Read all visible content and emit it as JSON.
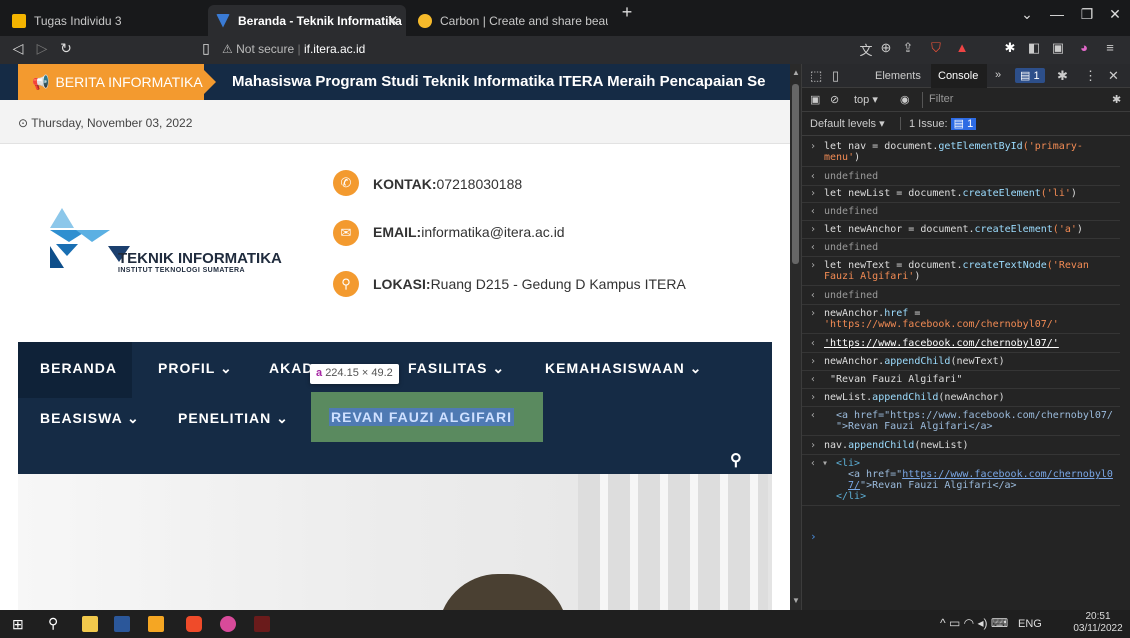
{
  "tabs": [
    {
      "label": "Tugas Individu 3",
      "active": false
    },
    {
      "label": "Beranda - Teknik Informatika",
      "active": true
    },
    {
      "label": "Carbon | Create and share beautiful im",
      "active": false
    }
  ],
  "address": {
    "security": "Not secure",
    "separator": "|",
    "url": "if.itera.ac.id"
  },
  "page": {
    "news_label": "BERITA INFORMATIKA",
    "news_text": "Mahasiswa Program Studi Teknik Informatika ITERA Meraih Pencapaian Se",
    "date": "Thursday, November 03, 2022",
    "logo_title": "TEKNIK INFORMATIKA",
    "logo_subtitle": "INSTITUT TEKNOLOGI SUMATERA",
    "contacts": [
      {
        "label": "KONTAK:",
        "value": "07218030188",
        "icon": "phone-icon"
      },
      {
        "label": "EMAIL:",
        "value": "informatika@itera.ac.id",
        "icon": "mail-icon"
      },
      {
        "label": "LOKASI:",
        "value": "Ruang D215 - Gedung D Kampus ITERA",
        "icon": "location-icon"
      }
    ],
    "menu_row1": [
      "BERANDA",
      "PROFIL ⌄",
      "AKAD",
      "FASILITAS ⌄",
      "KEMAHASISWAAN ⌄"
    ],
    "menu_row2": [
      "BEASISWA ⌄",
      "PENELITIAN ⌄",
      "REVAN FAUZI ALGIFARI"
    ],
    "tooltip_tag": "a",
    "tooltip_size": "224.15 × 49.2"
  },
  "devtools": {
    "tab_elements": "Elements",
    "tab_console": "Console",
    "badge": "1",
    "context": "top ▾",
    "filter_placeholder": "Filter",
    "levels": "Default levels ▾",
    "issues": "1 Issue:",
    "issues_count": "1",
    "undefined": "undefined",
    "lines": {
      "l1a": "let nav = document.",
      "l1b": "getElementById",
      "l1c": "('primary-",
      "l1d": "menu'",
      "l1e": ")",
      "l2a": "let newList = document.",
      "l2b": "createElement",
      "l2c": "('li'",
      "l2d": ")",
      "l3a": "let newAnchor = document.",
      "l3b": "createElement",
      "l3c": "('a'",
      "l3d": ")",
      "l4a": "let newText = document.",
      "l4b": "createTextNode",
      "l4c": "('Revan",
      "l4d": "Fauzi Algifari'",
      "l4e": ")",
      "l5a": "newAnchor.",
      "l5b": "href",
      "l5c": " =",
      "l5d": "'https://www.facebook.com/chernobyl07/'",
      "l5r": "'https://www.facebook.com/chernobyl07/'",
      "l6a": "newAnchor.",
      "l6b": "appendChild",
      "l6c": "(newText)",
      "l6r": "\"Revan Fauzi Algifari\"",
      "l7a": "newList.",
      "l7b": "appendChild",
      "l7c": "(newAnchor)",
      "l7r1": "<a href=\"https://www.facebook.com/chernobyl07/",
      "l7r2": "\">Revan Fauzi Algifari</a>",
      "l8a": "nav.",
      "l8b": "appendChild",
      "l8c": "(newList)",
      "l8r1": "<li>",
      "l8r2a": "<a href=\"",
      "l8r2b": "https://www.facebook.com/chernobyl0",
      "l8r3a": "7/",
      "l8r3b": "\">Revan Fauzi Algifari</a>",
      "l8r4": "</li>"
    }
  },
  "taskbar": {
    "lang": "ENG",
    "time": "20:51",
    "date": "03/11/2022"
  },
  "colors": {
    "accent_orange": "#f39a2f",
    "navy": "#152b45",
    "highlight_green": "#5a8a5f",
    "highlight_blue": "#4f7ab3"
  }
}
